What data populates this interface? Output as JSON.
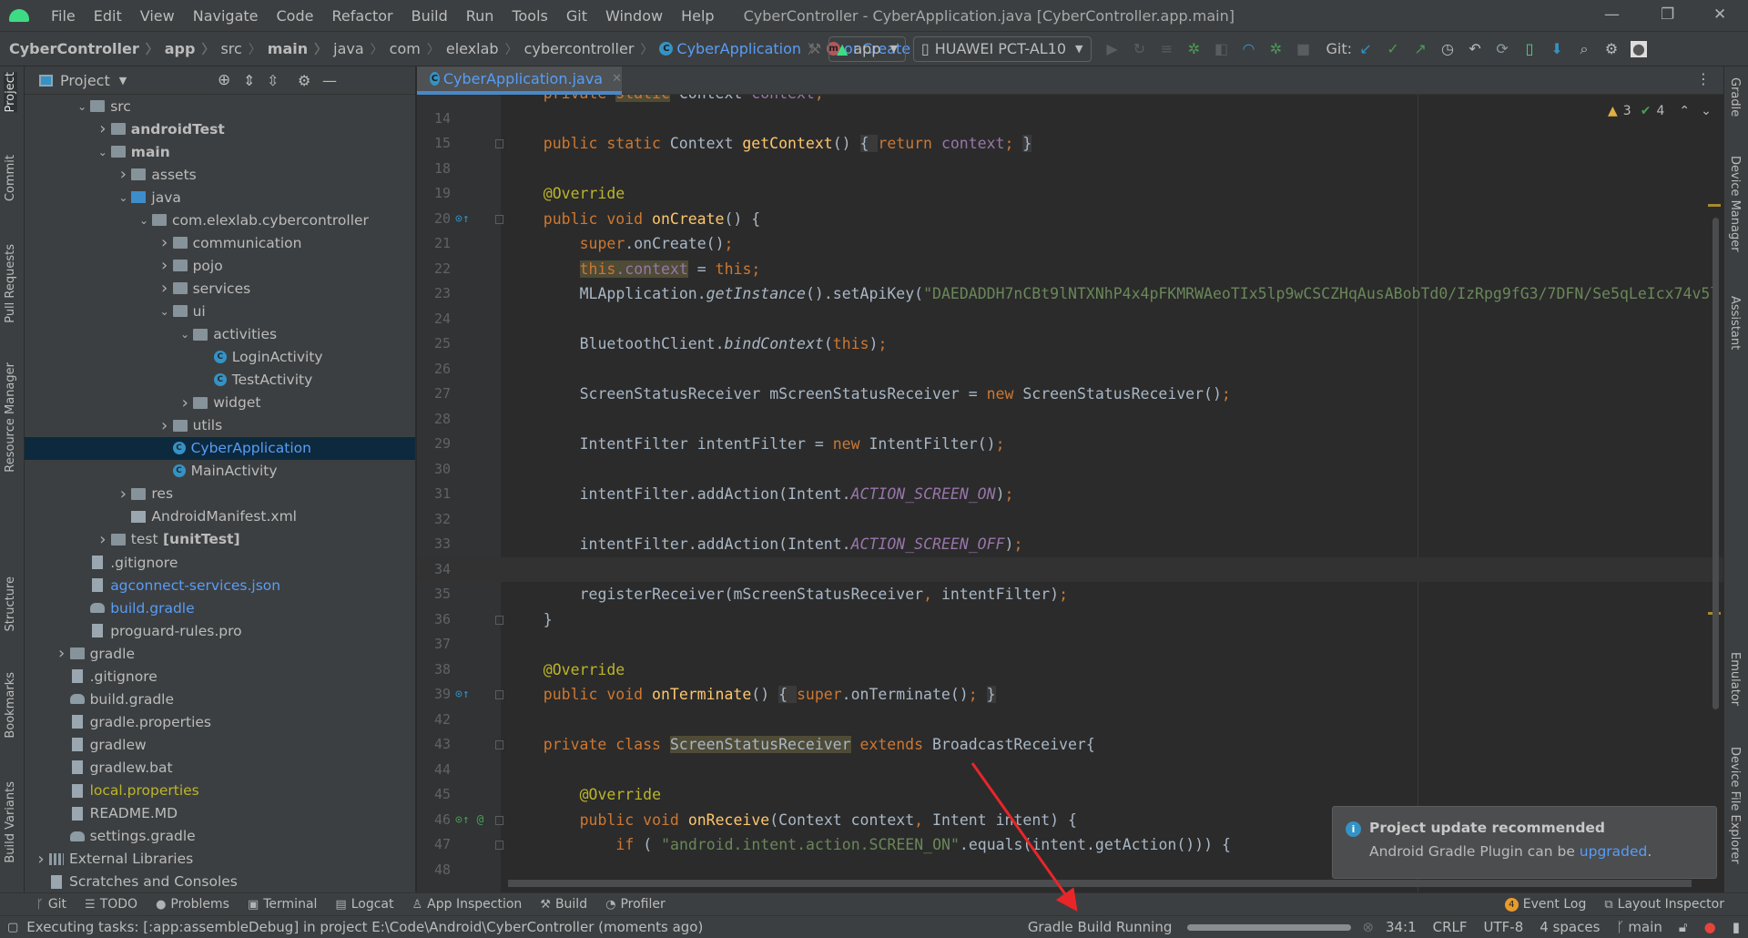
{
  "window": {
    "title": "CyberController - CyberApplication.java [CyberController.app.main]",
    "menu": [
      "File",
      "Edit",
      "View",
      "Navigate",
      "Code",
      "Refactor",
      "Build",
      "Run",
      "Tools",
      "Git",
      "Window",
      "Help"
    ],
    "controls": {
      "minimize": "—",
      "restore": "❐",
      "close": "✕"
    }
  },
  "breadcrumb": [
    {
      "label": "CyberController",
      "style": "bold"
    },
    {
      "label": "app",
      "style": "bold"
    },
    {
      "label": "src",
      "style": ""
    },
    {
      "label": "main",
      "style": "bold"
    },
    {
      "label": "java",
      "style": ""
    },
    {
      "label": "com",
      "style": ""
    },
    {
      "label": "elexlab",
      "style": ""
    },
    {
      "label": "cybercontroller",
      "style": ""
    },
    {
      "label": "CyberApplication",
      "style": "blue",
      "icon": "class-icon"
    },
    {
      "label": "onCreate",
      "style": "blue",
      "icon": "method-icon"
    }
  ],
  "toolbar": {
    "run_config": "app",
    "device": "HUAWEI PCT-AL10",
    "git_label": "Git:"
  },
  "left_strip": [
    "Project",
    "Commit",
    "Pull Requests",
    "Resource Manager",
    "Structure",
    "Bookmarks",
    "Build Variants"
  ],
  "right_strip": [
    "Gradle",
    "Device Manager",
    "Assistant",
    "Emulator",
    "Device File Explorer"
  ],
  "project_panel": {
    "title": "Project",
    "tree": [
      {
        "label": "src",
        "depth": 2,
        "expanded": true,
        "icon": "folder"
      },
      {
        "label": "androidTest",
        "depth": 3,
        "expanded": false,
        "icon": "folder",
        "style": "bold"
      },
      {
        "label": "main",
        "depth": 3,
        "expanded": true,
        "icon": "folder",
        "style": "bold"
      },
      {
        "label": "assets",
        "depth": 4,
        "expanded": false,
        "icon": "folder"
      },
      {
        "label": "java",
        "depth": 4,
        "expanded": true,
        "icon": "folder-blue"
      },
      {
        "label": "com.elexlab.cybercontroller",
        "depth": 5,
        "expanded": true,
        "icon": "folder"
      },
      {
        "label": "communication",
        "depth": 6,
        "expanded": false,
        "icon": "folder"
      },
      {
        "label": "pojo",
        "depth": 6,
        "expanded": false,
        "icon": "folder"
      },
      {
        "label": "services",
        "depth": 6,
        "expanded": false,
        "icon": "folder"
      },
      {
        "label": "ui",
        "depth": 6,
        "expanded": true,
        "icon": "folder"
      },
      {
        "label": "activities",
        "depth": 7,
        "expanded": true,
        "icon": "folder"
      },
      {
        "label": "LoginActivity",
        "depth": 8,
        "icon": "cls"
      },
      {
        "label": "TestActivity",
        "depth": 8,
        "icon": "cls"
      },
      {
        "label": "widget",
        "depth": 7,
        "expanded": false,
        "icon": "folder"
      },
      {
        "label": "utils",
        "depth": 6,
        "expanded": false,
        "icon": "folder"
      },
      {
        "label": "CyberApplication",
        "depth": 6,
        "icon": "cls",
        "selected": true,
        "style": "blue"
      },
      {
        "label": "MainActivity",
        "depth": 6,
        "icon": "cls"
      },
      {
        "label": "res",
        "depth": 4,
        "expanded": false,
        "icon": "folder"
      },
      {
        "label": "AndroidManifest.xml",
        "depth": 4,
        "icon": "xml"
      },
      {
        "label": "test",
        "suffix": " [unitTest]",
        "depth": 3,
        "expanded": false,
        "icon": "folder"
      },
      {
        "label": ".gitignore",
        "depth": 2,
        "icon": "file"
      },
      {
        "label": "agconnect-services.json",
        "depth": 2,
        "icon": "file",
        "style": "blue"
      },
      {
        "label": "build.gradle",
        "depth": 2,
        "icon": "gradle",
        "style": "blue"
      },
      {
        "label": "proguard-rules.pro",
        "depth": 2,
        "icon": "file"
      },
      {
        "label": "gradle",
        "depth": 1,
        "expanded": false,
        "icon": "folder"
      },
      {
        "label": ".gitignore",
        "depth": 1,
        "icon": "file"
      },
      {
        "label": "build.gradle",
        "depth": 1,
        "icon": "gradle"
      },
      {
        "label": "gradle.properties",
        "depth": 1,
        "icon": "file"
      },
      {
        "label": "gradlew",
        "depth": 1,
        "icon": "file"
      },
      {
        "label": "gradlew.bat",
        "depth": 1,
        "icon": "file"
      },
      {
        "label": "local.properties",
        "depth": 1,
        "icon": "file",
        "style": "yellow"
      },
      {
        "label": "README.MD",
        "depth": 1,
        "icon": "file"
      },
      {
        "label": "settings.gradle",
        "depth": 1,
        "icon": "gradle"
      },
      {
        "label": "External Libraries",
        "depth": 0,
        "expanded": false,
        "icon": "lib"
      },
      {
        "label": "Scratches and Consoles",
        "depth": 0,
        "icon": "file"
      }
    ]
  },
  "editor": {
    "tab": {
      "label": "CyberApplication.java",
      "close": "✕"
    },
    "inspections": {
      "warnings": "3",
      "weak_warnings": "4"
    },
    "current_line": 34,
    "lines": [
      {
        "n": "",
        "ind": 4,
        "t": [
          [
            "k",
            "private "
          ],
          [
            "kh",
            "static"
          ],
          [
            "d",
            " Context "
          ],
          [
            "fi",
            "context"
          ],
          [
            "k",
            ";"
          ]
        ]
      },
      {
        "n": "14",
        "ind": 0,
        "t": []
      },
      {
        "n": "15",
        "ind": 4,
        "fold": true,
        "t": [
          [
            "k",
            "public static "
          ],
          [
            "d",
            "Context "
          ],
          [
            "m",
            "getContext"
          ],
          [
            "d",
            "() "
          ],
          [
            "fb",
            "{ "
          ],
          [
            "k",
            "return "
          ],
          [
            "fi",
            "context"
          ],
          [
            "k",
            "; "
          ],
          [
            "fb",
            "}"
          ]
        ]
      },
      {
        "n": "18",
        "ind": 0,
        "t": []
      },
      {
        "n": "19",
        "ind": 4,
        "t": [
          [
            "a",
            "@Override"
          ]
        ]
      },
      {
        "n": "20",
        "ind": 4,
        "mark": "override",
        "fold": true,
        "t": [
          [
            "k",
            "public void "
          ],
          [
            "m",
            "onCreate"
          ],
          [
            "d",
            "() {"
          ]
        ]
      },
      {
        "n": "21",
        "ind": 8,
        "t": [
          [
            "k",
            "super"
          ],
          [
            "d",
            ".onCreate()"
          ],
          [
            "k",
            ";"
          ]
        ]
      },
      {
        "n": "22",
        "ind": 8,
        "t": [
          [
            "kh",
            "this"
          ],
          [
            "fh",
            ".context"
          ],
          [
            "d",
            " = "
          ],
          [
            "k",
            "this;"
          ]
        ]
      },
      {
        "n": "23",
        "ind": 8,
        "t": [
          [
            "d",
            "MLApplication."
          ],
          [
            "i",
            "getInstance"
          ],
          [
            "d",
            "().setApiKey("
          ],
          [
            "s",
            "\"DAEDADDH7nCBt9lNTXNhP4x4pFKMRWAeoTIx5lp9wCSCZHqAusABobTd0/IzRpg9fG3/7DFN/Se5qLeIcx74v5l"
          ]
        ]
      },
      {
        "n": "24",
        "ind": 0,
        "t": []
      },
      {
        "n": "25",
        "ind": 8,
        "t": [
          [
            "d",
            "BluetoothClient."
          ],
          [
            "i",
            "bindContext"
          ],
          [
            "d",
            "("
          ],
          [
            "k",
            "this"
          ],
          [
            "d",
            ")"
          ],
          [
            "k",
            ";"
          ]
        ]
      },
      {
        "n": "26",
        "ind": 0,
        "t": []
      },
      {
        "n": "27",
        "ind": 8,
        "t": [
          [
            "d",
            "ScreenStatusReceiver mScreenStatusReceiver = "
          ],
          [
            "k",
            "new "
          ],
          [
            "d",
            "ScreenStatusReceiver()"
          ],
          [
            "k",
            ";"
          ]
        ]
      },
      {
        "n": "28",
        "ind": 0,
        "t": []
      },
      {
        "n": "29",
        "ind": 8,
        "t": [
          [
            "d",
            "IntentFilter intentFilter = "
          ],
          [
            "k",
            "new "
          ],
          [
            "d",
            "IntentFilter()"
          ],
          [
            "k",
            ";"
          ]
        ]
      },
      {
        "n": "30",
        "ind": 0,
        "t": []
      },
      {
        "n": "31",
        "ind": 8,
        "t": [
          [
            "d",
            "intentFilter.addAction(Intent."
          ],
          [
            "c",
            "ACTION_SCREEN_ON"
          ],
          [
            "d",
            ")"
          ],
          [
            "k",
            ";"
          ]
        ]
      },
      {
        "n": "32",
        "ind": 0,
        "t": []
      },
      {
        "n": "33",
        "ind": 8,
        "t": [
          [
            "d",
            "intentFilter.addAction(Intent."
          ],
          [
            "c",
            "ACTION_SCREEN_OFF"
          ],
          [
            "d",
            ")"
          ],
          [
            "k",
            ";"
          ]
        ]
      },
      {
        "n": "34",
        "ind": 0,
        "t": []
      },
      {
        "n": "35",
        "ind": 8,
        "t": [
          [
            "d",
            "registerReceiver(mScreenStatusReceiver"
          ],
          [
            "k",
            ", "
          ],
          [
            "d",
            "intentFilter)"
          ],
          [
            "k",
            ";"
          ]
        ]
      },
      {
        "n": "36",
        "ind": 4,
        "fold": true,
        "t": [
          [
            "d",
            "}"
          ]
        ]
      },
      {
        "n": "37",
        "ind": 0,
        "t": []
      },
      {
        "n": "38",
        "ind": 4,
        "t": [
          [
            "a",
            "@Override"
          ]
        ]
      },
      {
        "n": "39",
        "ind": 4,
        "mark": "override",
        "fold": true,
        "t": [
          [
            "k",
            "public void "
          ],
          [
            "m",
            "onTerminate"
          ],
          [
            "d",
            "() "
          ],
          [
            "fb",
            "{ "
          ],
          [
            "k",
            "super"
          ],
          [
            "d",
            ".onTerminate()"
          ],
          [
            "k",
            "; "
          ],
          [
            "fb",
            "}"
          ]
        ]
      },
      {
        "n": "42",
        "ind": 0,
        "t": []
      },
      {
        "n": "43",
        "ind": 4,
        "fold": true,
        "t": [
          [
            "k",
            "private class "
          ],
          [
            "dh",
            "ScreenStatusReceiver"
          ],
          [
            "k",
            " extends "
          ],
          [
            "d",
            "BroadcastReceiver{"
          ]
        ]
      },
      {
        "n": "44",
        "ind": 0,
        "t": []
      },
      {
        "n": "45",
        "ind": 8,
        "t": [
          [
            "a",
            "@Override"
          ]
        ]
      },
      {
        "n": "46",
        "ind": 8,
        "mark": "implements",
        "fold": true,
        "t": [
          [
            "k",
            "public void "
          ],
          [
            "m",
            "onReceive"
          ],
          [
            "d",
            "(Context context"
          ],
          [
            "k",
            ", "
          ],
          [
            "d",
            "Intent intent) {"
          ]
        ]
      },
      {
        "n": "47",
        "ind": 12,
        "fold": true,
        "t": [
          [
            "k",
            "if "
          ],
          [
            "d",
            "( "
          ],
          [
            "s",
            "\"android.intent.action.SCREEN_ON\""
          ],
          [
            "d",
            ".equals(intent.getAction())) {"
          ]
        ]
      },
      {
        "n": "48",
        "ind": 0,
        "t": []
      }
    ]
  },
  "notification": {
    "title": "Project update recommended",
    "body_prefix": "Android Gradle Plugin can be ",
    "link": "upgraded",
    "body_suffix": "."
  },
  "bottom_tools": {
    "left": [
      "Git",
      "TODO",
      "Problems",
      "Terminal",
      "Logcat",
      "App Inspection",
      "Build",
      "Profiler"
    ],
    "event_log": "Event Log",
    "event_log_count": "4",
    "layout_inspector": "Layout Inspector"
  },
  "status_bar": {
    "message": "Executing tasks: [:app:assembleDebug] in project E:\\Code\\Android\\CyberController (moments ago)",
    "task": "Gradle Build Running",
    "position": "34:1",
    "line_separator": "CRLF",
    "encoding": "UTF-8",
    "indent": "4 spaces",
    "branch": "main"
  },
  "colors": {
    "accent": "#589DF6",
    "keyword": "#CC7832",
    "annotation": "#BBB529",
    "method": "#FFC66D",
    "field": "#9876AA",
    "string": "#6A8759",
    "arrow": "#E8262A"
  }
}
